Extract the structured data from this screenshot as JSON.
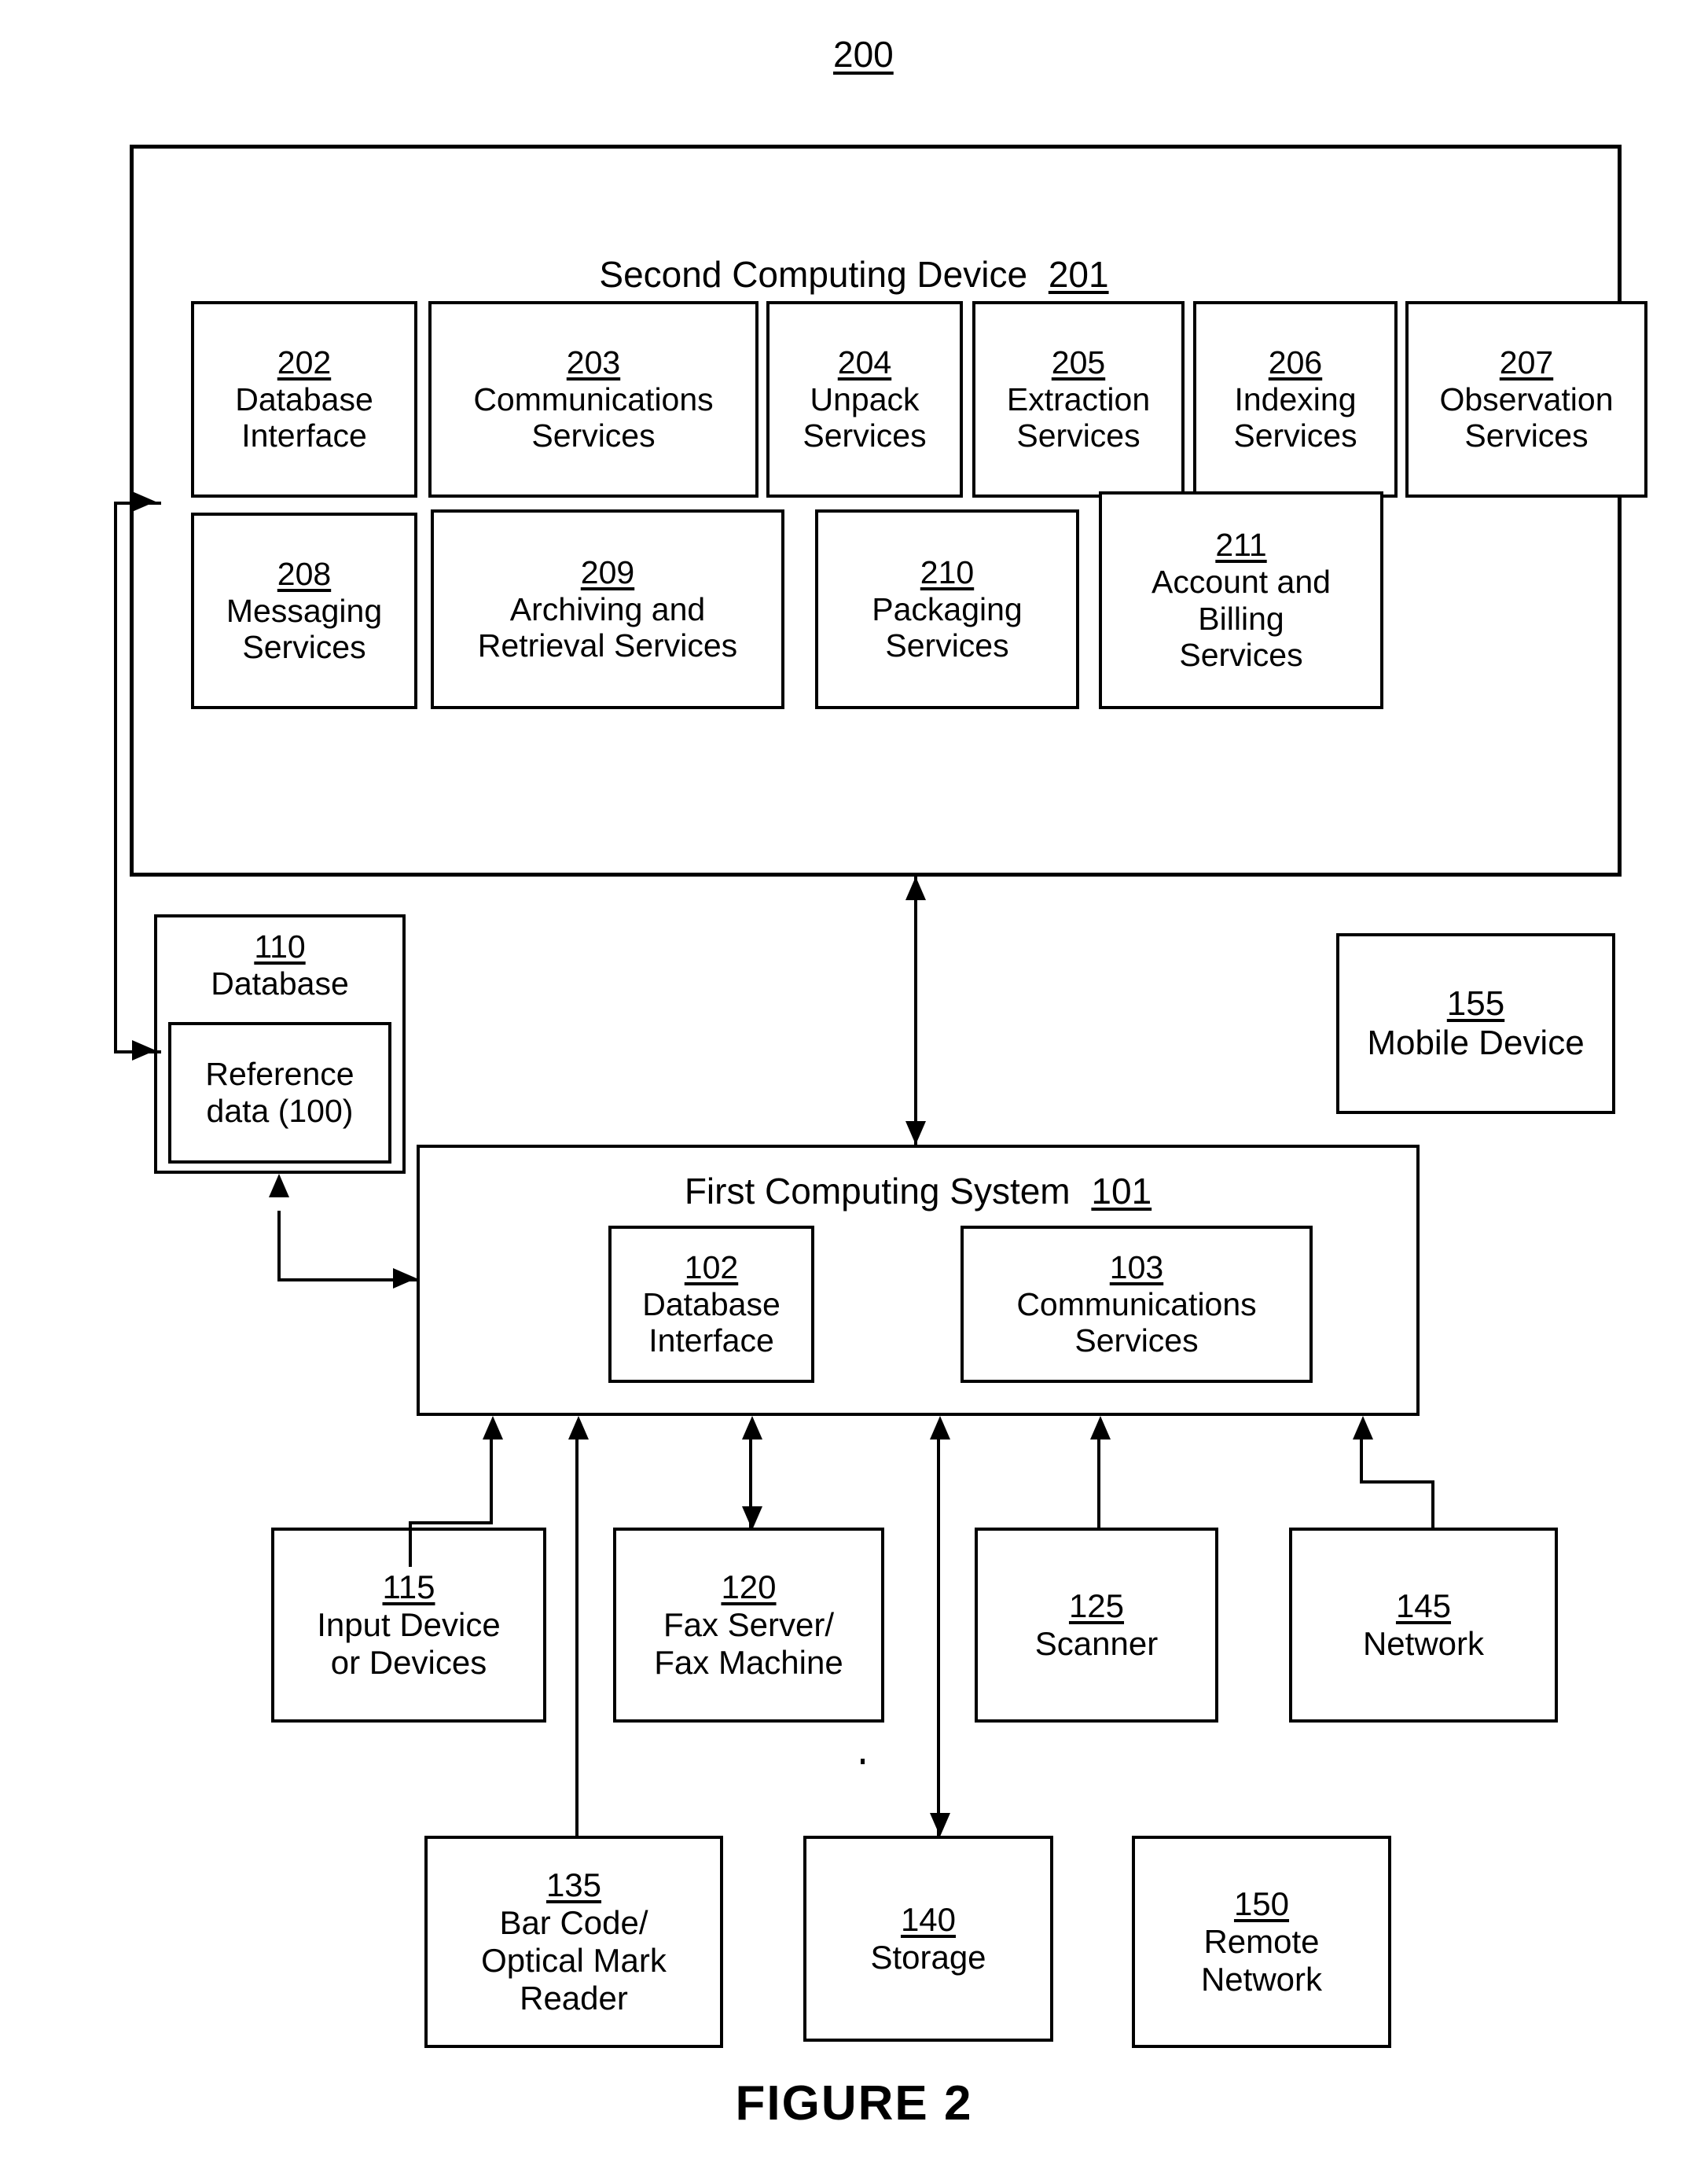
{
  "figure": {
    "top_reference": "200",
    "caption": "FIGURE 2"
  },
  "second_computing_device": {
    "title_text": "Second Computing Device",
    "title_ref": "201",
    "row1": [
      {
        "num": "202",
        "label": "Database\nInterface"
      },
      {
        "num": "203",
        "label": "Communications\nServices"
      },
      {
        "num": "204",
        "label": "Unpack\nServices"
      },
      {
        "num": "205",
        "label": "Extraction\nServices"
      },
      {
        "num": "206",
        "label": "Indexing\nServices"
      },
      {
        "num": "207",
        "label": "Observation\nServices"
      }
    ],
    "row2": [
      {
        "num": "208",
        "label": "Messaging\nServices"
      },
      {
        "num": "209",
        "label": "Archiving and\nRetrieval Services"
      },
      {
        "num": "210",
        "label": "Packaging\nServices"
      },
      {
        "num": "211",
        "label": "Account and\nBilling\nServices"
      }
    ]
  },
  "database": {
    "num": "110",
    "label": "Database",
    "inner": {
      "label": "Reference\ndata (100)"
    }
  },
  "mobile_device": {
    "num": "155",
    "label": "Mobile Device"
  },
  "first_computing_system": {
    "title_text": "First Computing System",
    "title_ref": "101",
    "modules": [
      {
        "num": "102",
        "label": "Database\nInterface"
      },
      {
        "num": "103",
        "label": "Communications\nServices"
      }
    ]
  },
  "peripherals": [
    {
      "num": "115",
      "label": "Input Device\nor Devices"
    },
    {
      "num": "120",
      "label": "Fax Server/\nFax Machine"
    },
    {
      "num": "125",
      "label": "Scanner"
    },
    {
      "num": "145",
      "label": "Network"
    },
    {
      "num": "135",
      "label": "Bar Code/\nOptical Mark\nReader"
    },
    {
      "num": "140",
      "label": "Storage"
    },
    {
      "num": "150",
      "label": "Remote\nNetwork"
    }
  ],
  "colors": {
    "ink": "#000000",
    "paper": "#ffffff"
  }
}
